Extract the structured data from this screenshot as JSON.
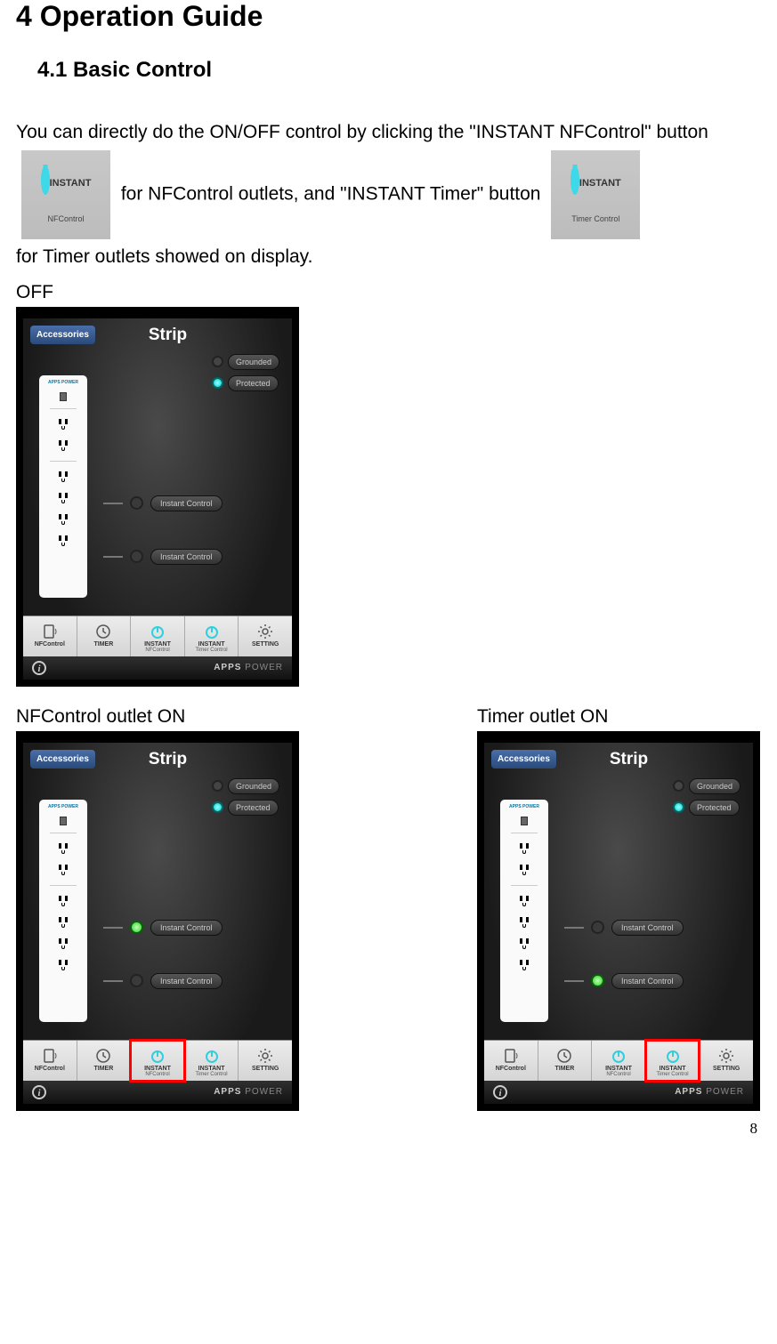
{
  "heading": "4  Operation Guide",
  "subheading": "4.1   Basic Control",
  "p1a": "You can directly do the ON/OFF control by clicking the \"INSTANT NFControl\" button",
  "p1b": "for NFControl outlets, and \"INSTANT Timer\" button",
  "p1c": "for Timer outlets showed on display.",
  "btn1": {
    "line1": "INSTANT",
    "line2": "NFControl"
  },
  "btn2": {
    "line1": "INSTANT",
    "line2": "Timer Control"
  },
  "labels": {
    "off": "OFF",
    "nf_on": "NFControl outlet ON",
    "timer_on": "Timer outlet ON"
  },
  "shot": {
    "accessories": "Accessories",
    "title": "Strip",
    "grounded": "Grounded",
    "protected": "Protected",
    "instant_control": "Instant Control",
    "strip_logo": "APPS POWER",
    "nav": {
      "nfcontrol": "NFControl",
      "timer": "TIMER",
      "instant_nf": "INSTANT",
      "instant_nf2": "NFControl",
      "instant_t": "INSTANT",
      "instant_t2": "Timer Control",
      "setting": "SETTING"
    },
    "info_glyph": "i",
    "brand": "APPS POWER"
  },
  "page_num": "8"
}
